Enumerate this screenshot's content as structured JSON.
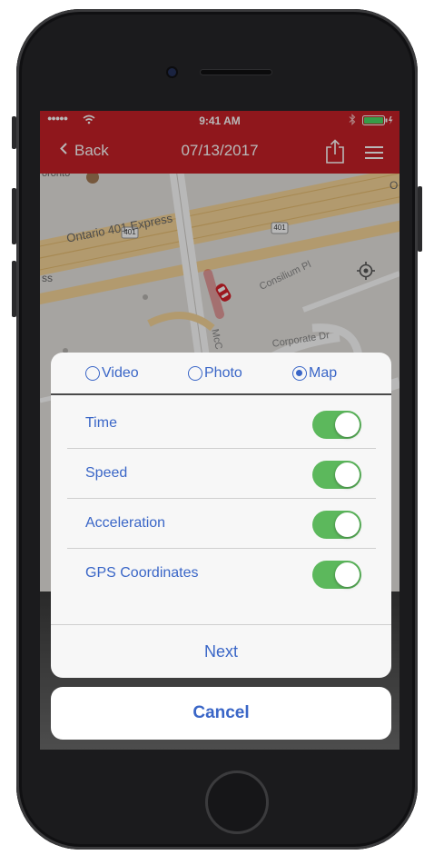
{
  "status_bar": {
    "signal": "●●●●●",
    "wifi": "wifi",
    "time": "9:41 AM",
    "bluetooth": "bluetooth",
    "battery": "battery"
  },
  "nav": {
    "back_label": "Back",
    "title": "07/13/2017",
    "share_icon": "share-icon",
    "menu_icon": "menu-icon"
  },
  "map": {
    "labels": {
      "highway": "Ontario 401 Express",
      "route_left": "401",
      "route_right": "401",
      "street_consilium": "Consilium Pl",
      "street_corporate": "Corporate Dr",
      "street_mcc": "McC",
      "edge_left": "ss",
      "edge_top_right": "O",
      "edge_top_left": "oronto"
    },
    "locate_icon": "crosshair-icon",
    "car_icon": "car-icon"
  },
  "sheet": {
    "tabs": [
      {
        "label": "Video",
        "selected": false
      },
      {
        "label": "Photo",
        "selected": false
      },
      {
        "label": "Map",
        "selected": true
      }
    ],
    "options": [
      {
        "label": "Time",
        "on": true
      },
      {
        "label": "Speed",
        "on": true
      },
      {
        "label": "Acceleration",
        "on": true
      },
      {
        "label": "GPS Coordinates",
        "on": true
      }
    ],
    "next_label": "Next",
    "cancel_label": "Cancel"
  },
  "colors": {
    "brand_red": "#c62127",
    "accent_blue": "#3a66c7",
    "toggle_green": "#5cb85c"
  }
}
